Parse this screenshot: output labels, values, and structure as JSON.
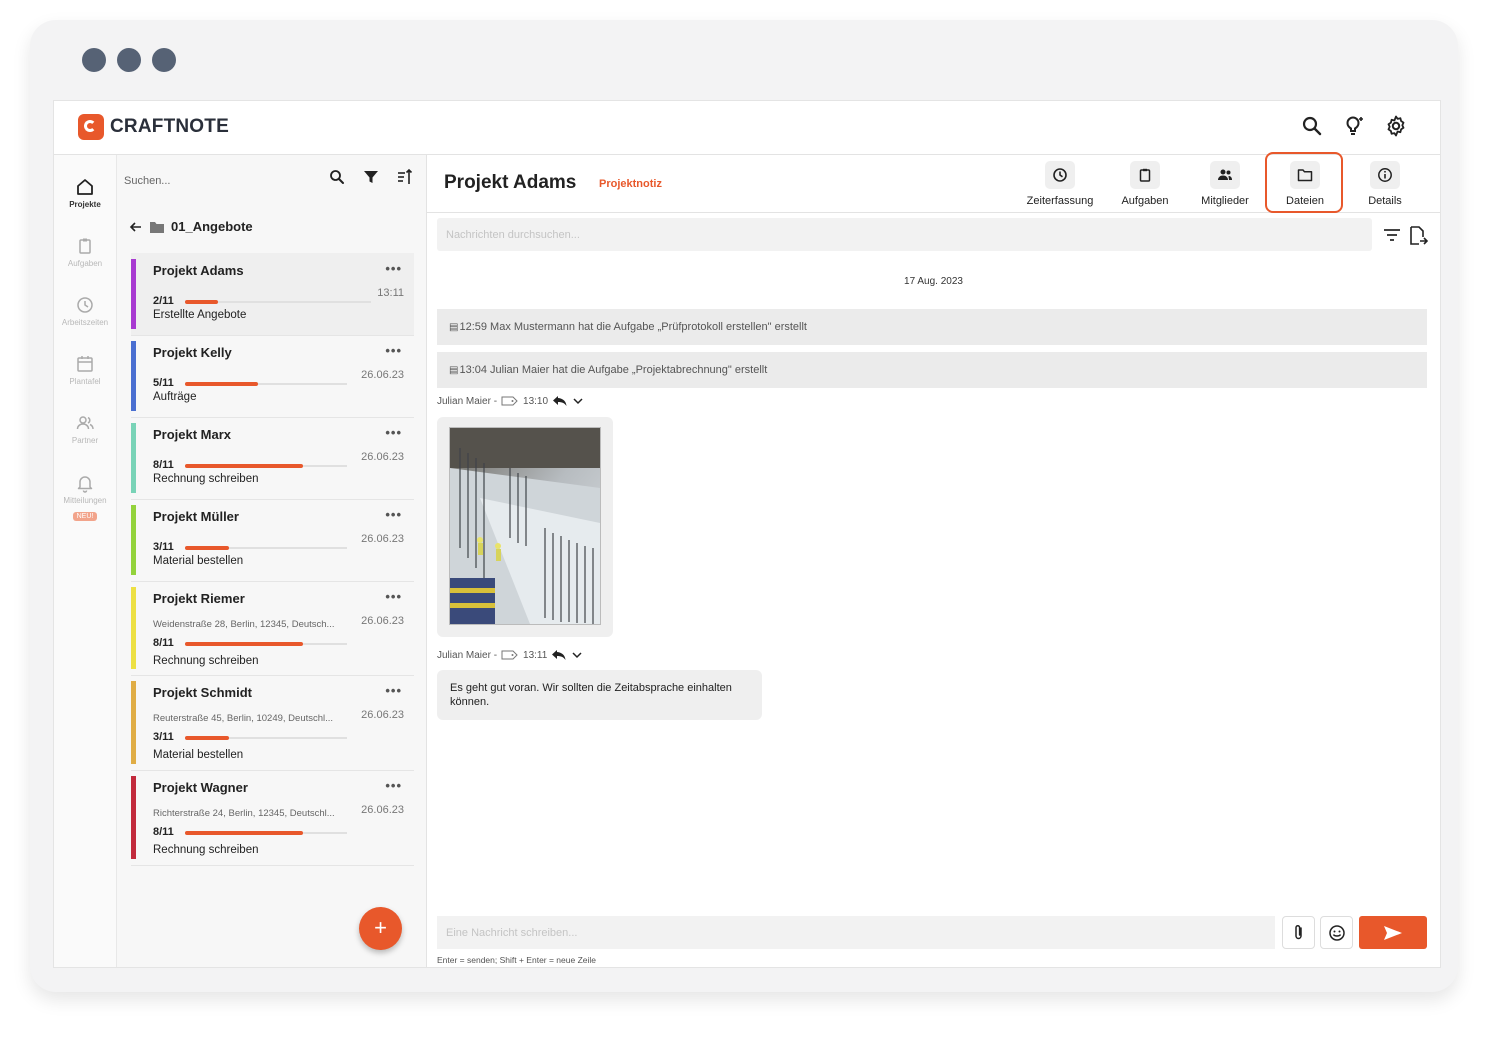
{
  "app": {
    "logo_text": "CRAFTNOTE"
  },
  "colors": {
    "accent": "#e8582b",
    "rail_active": "#333333"
  },
  "top_icons": [
    "search-icon",
    "lightbulb-icon",
    "gear-icon"
  ],
  "rail": [
    {
      "label": "Projekte",
      "icon": "home-icon",
      "active": true
    },
    {
      "label": "Aufgaben",
      "icon": "clipboard-icon"
    },
    {
      "label": "Arbeitszeiten",
      "icon": "clock-icon"
    },
    {
      "label": "Plantafel",
      "icon": "calendar-icon"
    },
    {
      "label": "Partner",
      "icon": "people-icon"
    },
    {
      "label": "Mitteilungen",
      "icon": "bell-icon",
      "badge": "NEU!"
    }
  ],
  "list": {
    "search_placeholder": "Suchen...",
    "folder": "01_Angebote",
    "projects": [
      {
        "name": "Projekt Adams",
        "date": "13:11",
        "count": "2/11",
        "progress": 0.18,
        "status": "Erstellte Angebote",
        "color": "#a83ad1",
        "address": ""
      },
      {
        "name": "Projekt Kelly",
        "date": "26.06.23",
        "count": "5/11",
        "progress": 0.45,
        "status": "Aufträge",
        "color": "#4a6fd1",
        "address": ""
      },
      {
        "name": "Projekt Marx",
        "date": "26.06.23",
        "count": "8/11",
        "progress": 0.73,
        "status": "Rechnung schreiben",
        "color": "#79d3b7",
        "address": ""
      },
      {
        "name": "Projekt Müller",
        "date": "26.06.23",
        "count": "3/11",
        "progress": 0.27,
        "status": "Material bestellen",
        "color": "#93d23b",
        "address": ""
      },
      {
        "name": "Projekt Riemer",
        "date": "26.06.23",
        "count": "8/11",
        "progress": 0.73,
        "status": "Rechnung schreiben",
        "color": "#ede043",
        "address": "Weidenstraße 28, Berlin, 12345, Deutsch..."
      },
      {
        "name": "Projekt Schmidt",
        "date": "26.06.23",
        "count": "3/11",
        "progress": 0.27,
        "status": "Material bestellen",
        "color": "#e0ad45",
        "address": "Reuterstraße 45, Berlin, 10249, Deutschl..."
      },
      {
        "name": "Projekt Wagner",
        "date": "26.06.23",
        "count": "8/11",
        "progress": 0.73,
        "status": "Rechnung schreiben",
        "color": "#c22a3c",
        "address": "Richterstraße 24, Berlin, 12345, Deutschl..."
      }
    ],
    "fab_label": "+"
  },
  "chat": {
    "title": "Projekt Adams",
    "tag": "Projektnotiz",
    "tabs": [
      {
        "label": "Zeiterfassung",
        "icon": "clock-icon"
      },
      {
        "label": "Aufgaben",
        "icon": "clipboard-icon"
      },
      {
        "label": "Mitglieder",
        "icon": "members-icon"
      },
      {
        "label": "Dateien",
        "icon": "folder-icon",
        "highlighted": true
      },
      {
        "label": "Details",
        "icon": "info-icon"
      }
    ],
    "search_placeholder": "Nachrichten durchsuchen...",
    "date_label": "17 Aug. 2023",
    "system_messages": [
      "12:59 Max Mustermann hat die Aufgabe „Prüfprotokoll erstellen\" erstellt",
      "13:04 Julian Maier hat die Aufgabe „Projektabrechnung\" erstellt"
    ],
    "messages": [
      {
        "author": "Julian Maier -",
        "time": "13:10",
        "type": "image"
      },
      {
        "author": "Julian Maier -",
        "time": "13:11",
        "type": "text",
        "text": "Es geht gut voran. Wir sollten die Zeitabsprache einhalten können."
      }
    ],
    "compose_placeholder": "Eine Nachricht schreiben...",
    "hint": "Enter = senden; Shift + Enter = neue Zeile"
  }
}
